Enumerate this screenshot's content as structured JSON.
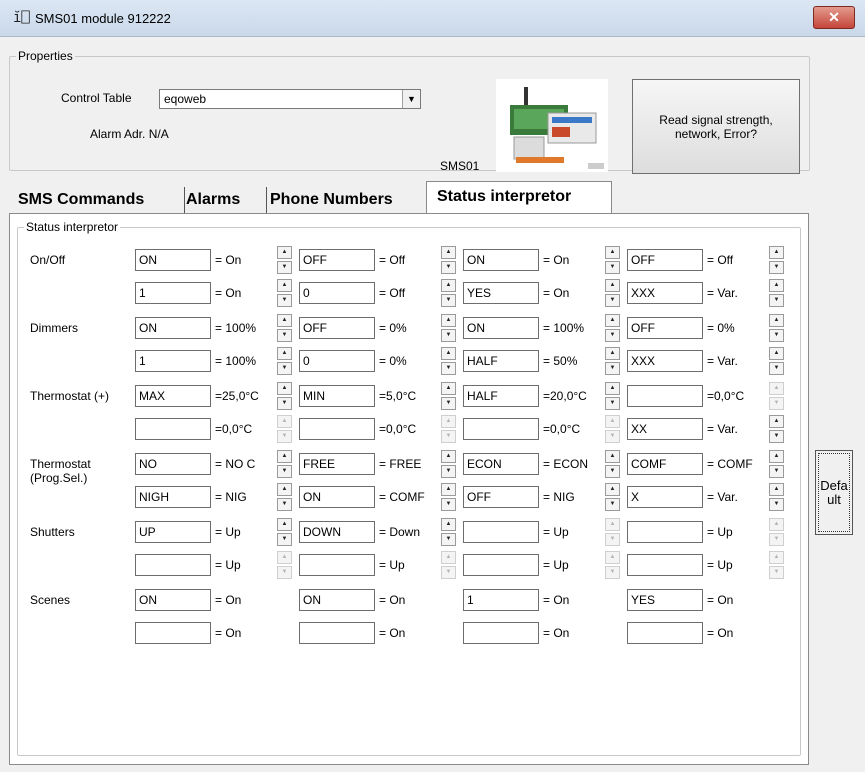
{
  "window": {
    "title": "SMS01 module 912222",
    "icon": "module-icon",
    "close_label": "✕"
  },
  "properties": {
    "legend": "Properties",
    "control_table_label": "Control Table",
    "control_table_value": "eqoweb",
    "alarm_addr": "Alarm Adr. N/A",
    "module_label": "SMS01",
    "read_button": "Read signal strength, network, Error?"
  },
  "tabs": [
    "SMS Commands",
    "Alarms",
    "Phone Numbers",
    "Status interpretor"
  ],
  "active_tab": "Status interpretor",
  "status": {
    "legend": "Status interpretor",
    "rows": [
      {
        "label": "On/Off",
        "cells": [
          {
            "value": "ON",
            "eq": "= On"
          },
          {
            "value": "OFF",
            "eq": "= Off"
          },
          {
            "value": "ON",
            "eq": "= On"
          },
          {
            "value": "OFF",
            "eq": "= Off"
          },
          {
            "value": "1",
            "eq": "= On"
          },
          {
            "value": "0",
            "eq": "= Off"
          },
          {
            "value": "YES",
            "eq": "= On"
          },
          {
            "value": "XXX",
            "eq": "= Var."
          }
        ]
      },
      {
        "label": "Dimmers",
        "cells": [
          {
            "value": "ON",
            "eq": "= 100%"
          },
          {
            "value": "OFF",
            "eq": "=  0%"
          },
          {
            "value": "ON",
            "eq": "= 100%"
          },
          {
            "value": "OFF",
            "eq": "=  0%"
          },
          {
            "value": "1",
            "eq": "= 100%"
          },
          {
            "value": "0",
            "eq": "=  0%"
          },
          {
            "value": "HALF",
            "eq": "=  50%"
          },
          {
            "value": "XXX",
            "eq": "= Var."
          }
        ]
      },
      {
        "label": "Thermostat (+)",
        "cells": [
          {
            "value": "MAX",
            "eq": "=25,0°C"
          },
          {
            "value": "MIN",
            "eq": "=5,0°C"
          },
          {
            "value": "HALF",
            "eq": "=20,0°C"
          },
          {
            "value": "",
            "eq": "=0,0°C"
          },
          {
            "value": "",
            "eq": "=0,0°C"
          },
          {
            "value": "",
            "eq": "=0,0°C"
          },
          {
            "value": "",
            "eq": "=0,0°C"
          },
          {
            "value": "XX",
            "eq": "= Var."
          }
        ]
      },
      {
        "label": "Thermostat (Prog.Sel.)",
        "cells": [
          {
            "value": "NO",
            "eq": "= NO C"
          },
          {
            "value": "FREE",
            "eq": "= FREE"
          },
          {
            "value": "ECON",
            "eq": "= ECON"
          },
          {
            "value": "COMF",
            "eq": "= COMF"
          },
          {
            "value": "NIGH",
            "eq": "=  NIG"
          },
          {
            "value": "ON",
            "eq": "= COMF"
          },
          {
            "value": "OFF",
            "eq": "=  NIG"
          },
          {
            "value": "X",
            "eq": "= Var."
          }
        ]
      },
      {
        "label": "Shutters",
        "cells": [
          {
            "value": "UP",
            "eq": "= Up"
          },
          {
            "value": "DOWN",
            "eq": "= Down"
          },
          {
            "value": "",
            "eq": "= Up"
          },
          {
            "value": "",
            "eq": "= Up"
          },
          {
            "value": "",
            "eq": "= Up"
          },
          {
            "value": "",
            "eq": "= Up"
          },
          {
            "value": "",
            "eq": "= Up"
          },
          {
            "value": "",
            "eq": "= Up"
          }
        ]
      },
      {
        "label": "Scenes",
        "cells": [
          {
            "value": "ON",
            "eq": "= On"
          },
          {
            "value": "ON",
            "eq": "= On"
          },
          {
            "value": "1",
            "eq": "= On"
          },
          {
            "value": "YES",
            "eq": "= On"
          },
          {
            "value": "",
            "eq": "= On"
          },
          {
            "value": "",
            "eq": "= On"
          },
          {
            "value": "",
            "eq": "= On"
          },
          {
            "value": "",
            "eq": "= On"
          }
        ]
      }
    ]
  },
  "default_button": "Defa ult"
}
